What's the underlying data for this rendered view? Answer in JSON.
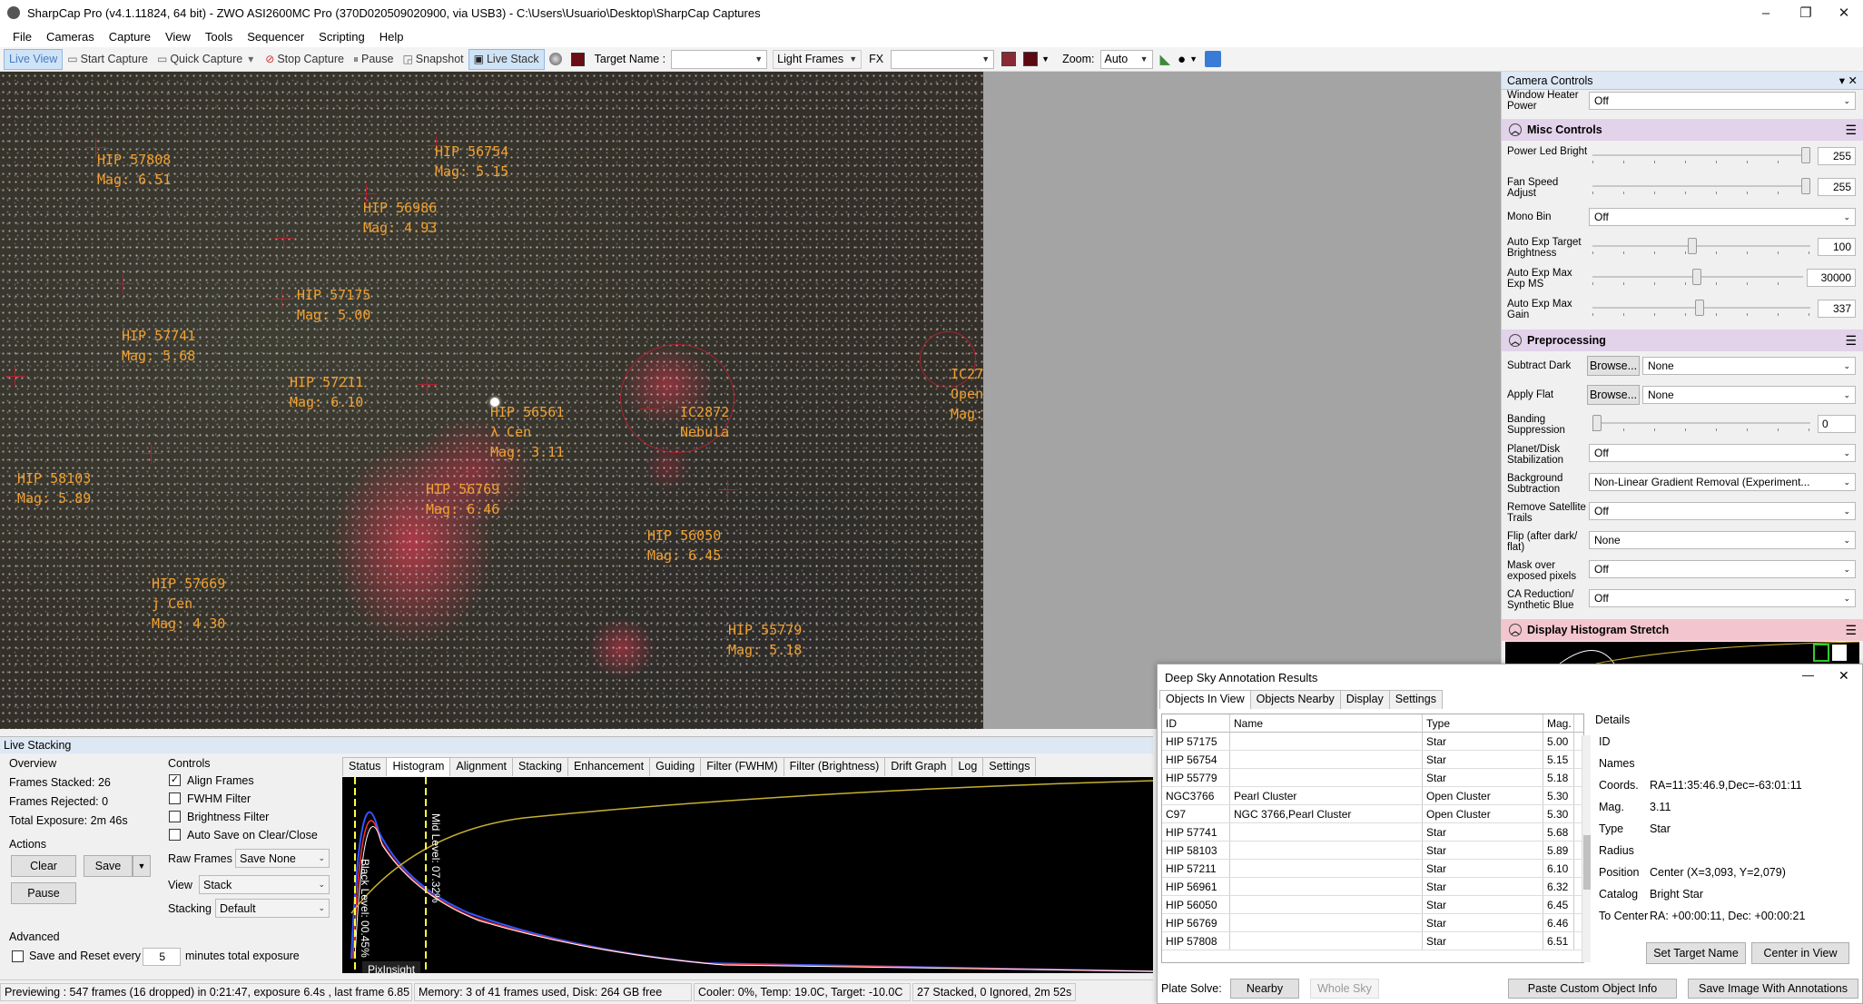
{
  "window": {
    "title": "SharpCap Pro (v4.1.11824, 64 bit) - ZWO ASI2600MC Pro (370D020509020900, via USB3) - C:\\Users\\Usuario\\Desktop\\SharpCap Captures",
    "minimize": "–",
    "restore": "❐",
    "close": "✕"
  },
  "menu": [
    "File",
    "Cameras",
    "Capture",
    "View",
    "Tools",
    "Sequencer",
    "Scripting",
    "Help"
  ],
  "toolbar": {
    "live_view": "Live View",
    "start_capture": "Start Capture",
    "quick_capture": "Quick Capture",
    "stop_capture": "Stop Capture",
    "pause": "Pause",
    "snapshot": "Snapshot",
    "live_stack": "Live Stack",
    "target_name_label": "Target Name :",
    "target_name_value": "",
    "frame_type": "Light Frames",
    "fx_label": "FX",
    "fx_value": "",
    "zoom_label": "Zoom:",
    "zoom_value": "Auto"
  },
  "annotations": [
    {
      "id": "a1",
      "text": "HIP 57808\nMag: 6.51"
    },
    {
      "id": "a2",
      "text": "HIP 56754\nMag: 5.15"
    },
    {
      "id": "a3",
      "text": "HIP 56986\nMag: 4.93"
    },
    {
      "id": "a4",
      "text": "HIP 57175\nMag: 5.00"
    },
    {
      "id": "a5",
      "text": "HIP 57741\nMag: 5.68"
    },
    {
      "id": "a6",
      "text": "HIP 57211\nMag: 6.10"
    },
    {
      "id": "a7",
      "text": "HIP 56561\nλ Cen\nMag: 3.11"
    },
    {
      "id": "a8",
      "text": "IC2872\nNebula"
    },
    {
      "id": "a9",
      "text": "IC27\nOpen\nMag:"
    },
    {
      "id": "a10",
      "text": "HIP 58103\nMag: 5.89"
    },
    {
      "id": "a11",
      "text": "HIP 56769\nMag: 6.46"
    },
    {
      "id": "a12",
      "text": "HIP 56050\nMag: 6.45"
    },
    {
      "id": "a13",
      "text": "HIP 57669\nj Cen\nMag: 4.30"
    },
    {
      "id": "a14",
      "text": "HIP 55779\nMag: 5.18"
    }
  ],
  "camera_controls": {
    "header": "Camera Controls",
    "pin": "▾ ✕",
    "window_heater": {
      "label": "Window Heater Power",
      "value": "Off"
    },
    "misc": {
      "title": "Misc Controls",
      "power_led": {
        "label": "Power Led Bright",
        "value": "255"
      },
      "fan_speed": {
        "label": "Fan Speed Adjust",
        "value": "255"
      },
      "mono_bin": {
        "label": "Mono Bin",
        "value": "Off"
      },
      "auto_exp_target": {
        "label": "Auto Exp Target Brightness",
        "value": "100"
      },
      "auto_exp_max_ms": {
        "label": "Auto Exp Max Exp MS",
        "value": "30000"
      },
      "auto_exp_max_gain": {
        "label": "Auto Exp Max Gain",
        "value": "337"
      }
    },
    "pre": {
      "title": "Preprocessing",
      "subtract_dark": {
        "label": "Subtract Dark",
        "button": "Browse...",
        "value": "None"
      },
      "apply_flat": {
        "label": "Apply Flat",
        "button": "Browse...",
        "value": "None"
      },
      "banding": {
        "label": "Banding Suppression",
        "value": "0"
      },
      "planet_disk": {
        "label": "Planet/Disk Stabilization",
        "value": "Off"
      },
      "background": {
        "label": "Background Subtraction",
        "value": "Non-Linear Gradient Removal (Experiment..."
      },
      "satellite": {
        "label": "Remove Satellite Trails",
        "value": "Off"
      },
      "flip": {
        "label": "Flip (after dark/ flat)",
        "value": "None"
      },
      "mask": {
        "label": "Mask over exposed pixels",
        "value": "Off"
      },
      "ca": {
        "label": "CA Reduction/ Synthetic Blue",
        "value": "Off"
      }
    },
    "hist_title": "Display Histogram Stretch"
  },
  "live_stacking": {
    "header": "Live Stacking",
    "overview": "Overview",
    "frames_stacked": "Frames Stacked:  26",
    "frames_rejected": "Frames Rejected:  0",
    "total_exposure": "Total Exposure:   2m 46s",
    "actions": "Actions",
    "clear": "Clear",
    "save": "Save",
    "pause": "Pause",
    "advanced": "Advanced",
    "save_reset": "Save and Reset every",
    "minutes_value": "5",
    "minutes_label": "minutes total exposure",
    "controls": "Controls",
    "align_frames": "Align Frames",
    "fwhm_filter": "FWHM Filter",
    "brightness_filter": "Brightness Filter",
    "auto_save": "Auto Save on Clear/Close",
    "raw_frames_label": "Raw Frames",
    "raw_frames_value": "Save None",
    "view_label": "View",
    "view_value": "Stack",
    "stacking_label": "Stacking",
    "stacking_value": "Default",
    "tabs": [
      "Status",
      "Histogram",
      "Alignment",
      "Stacking",
      "Enhancement",
      "Guiding",
      "Filter (FWHM)",
      "Filter (Brightness)",
      "Drift Graph",
      "Log",
      "Settings"
    ],
    "black_level": "Black Level: 00.45%",
    "mid_level": "Mid Level: 07.32%",
    "tooltip": "PixInsight"
  },
  "status_bar": {
    "preview": "Previewing : 547 frames (16 dropped) in 0:21:47, exposure 6.4s , last frame 6.85",
    "memory": "Memory: 3 of 41 frames used, Disk: 264 GB free",
    "cooler": "Cooler: 0%, Temp: 19.0C, Target: -10.0C",
    "stacked": "27 Stacked, 0 Ignored, 2m 52s"
  },
  "dsa": {
    "title": "Deep Sky Annotation Results",
    "minimize": "—",
    "close": "✕",
    "tabs": [
      "Objects In View",
      "Objects Nearby",
      "Display",
      "Settings"
    ],
    "columns": [
      "ID",
      "Name",
      "Type",
      "Mag."
    ],
    "rows": [
      [
        "HIP 57175",
        "",
        "Star",
        "5.00"
      ],
      [
        "HIP 56754",
        "",
        "Star",
        "5.15"
      ],
      [
        "HIP 55779",
        "",
        "Star",
        "5.18"
      ],
      [
        "NGC3766",
        "Pearl Cluster",
        "Open Cluster",
        "5.30"
      ],
      [
        "C97",
        "NGC 3766,Pearl Cluster",
        "Open Cluster",
        "5.30"
      ],
      [
        "HIP 57741",
        "",
        "Star",
        "5.68"
      ],
      [
        "HIP 58103",
        "",
        "Star",
        "5.89"
      ],
      [
        "HIP 57211",
        "",
        "Star",
        "6.10"
      ],
      [
        "HIP 56961",
        "",
        "Star",
        "6.32"
      ],
      [
        "HIP 56050",
        "",
        "Star",
        "6.45"
      ],
      [
        "HIP 56769",
        "",
        "Star",
        "6.46"
      ],
      [
        "HIP 57808",
        "",
        "Star",
        "6.51"
      ]
    ],
    "details": {
      "title": "Details",
      "id": "ID",
      "names": "Names",
      "coords_l": "Coords.",
      "coords_v": "RA=11:35:46.9,Dec=-63:01:11",
      "mag_l": "Mag.",
      "mag_v": "3.11",
      "type_l": "Type",
      "type_v": "Star",
      "radius_l": "Radius",
      "position_l": "Position",
      "position_v": "Center (X=3,093, Y=2,079)",
      "catalog_l": "Catalog",
      "catalog_v": "Bright Star",
      "tocenter_l": "To Center",
      "tocenter_v": "RA: +00:00:11, Dec: +00:00:21"
    },
    "set_target": "Set Target Name",
    "center_view": "Center in View",
    "plate_solve": "Plate Solve:",
    "nearby": "Nearby",
    "whole_sky": "Whole Sky",
    "paste_custom": "Paste Custom Object Info",
    "save_image": "Save Image With Annotations"
  }
}
